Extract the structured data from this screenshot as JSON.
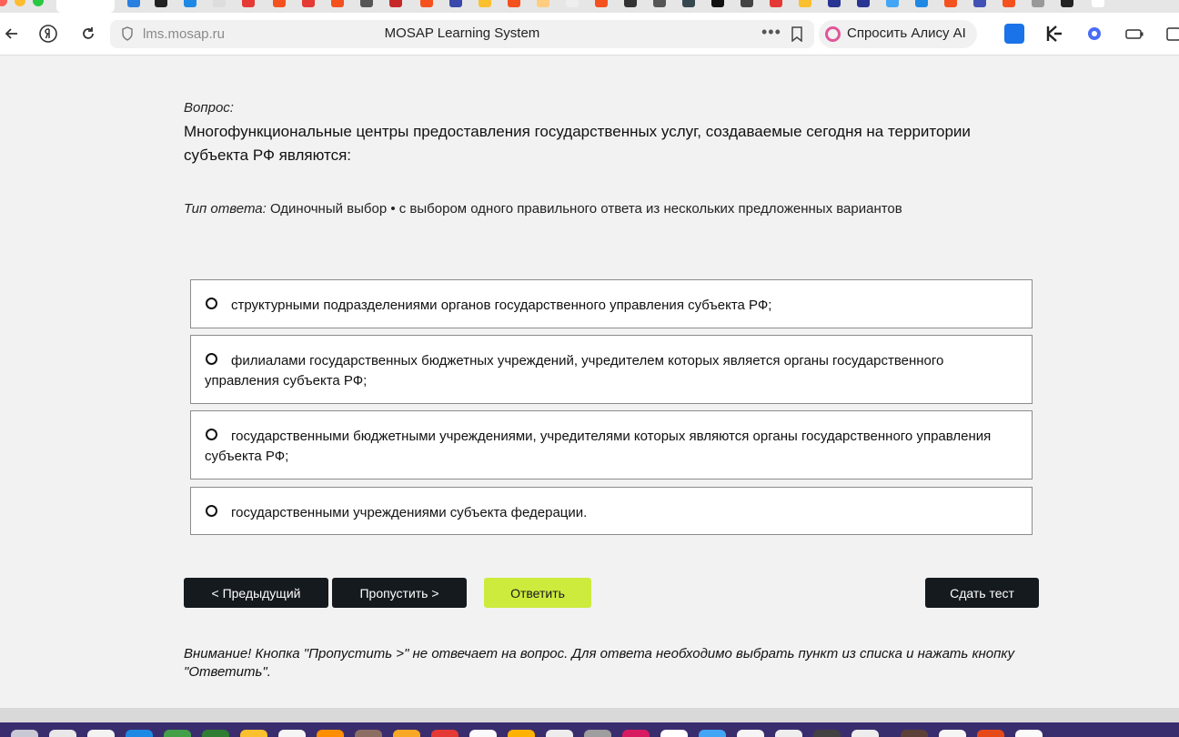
{
  "browser": {
    "url": "lms.mosap.ru",
    "page_title": "MOSAP Learning System",
    "alice_label": "Спросить Алису AI",
    "more_glyph": "•••"
  },
  "question": {
    "label": "Вопрос:",
    "text": "Многофункциональные центры предоставления государственных услуг, создаваемые сегодня на территории субъекта РФ являются:",
    "type_label": "Тип ответа:",
    "type_value": " Одиночный выбор • с выбором одного правильного ответа из нескольких предложенных вариантов"
  },
  "options": [
    "структурными подразделениями органов государственного управления субъекта РФ;",
    "филиалами государственных бюджетных учреждений, учредителем которых является органы государственного управления субъекта РФ;",
    "государственными бюджетными учреждениями, учредителями которых являются органы государственного управления субъекта РФ;",
    "государственными учреждениями субъекта федерации."
  ],
  "buttons": {
    "prev": "< Предыдущий",
    "skip": "Пропустить >",
    "answer": "Ответить",
    "submit": "Сдать тест"
  },
  "warning": "Внимание! Кнопка \"Пропустить >\" не отвечает на вопрос. Для ответа необходимо выбрать пункт из списка и нажать кнопку \"Ответить\".",
  "colors": {
    "page_background": "#f2f2f2",
    "dark_button": "#151a1f",
    "answer_button": "#cdeb3c",
    "option_border": "#8c8c8c"
  }
}
